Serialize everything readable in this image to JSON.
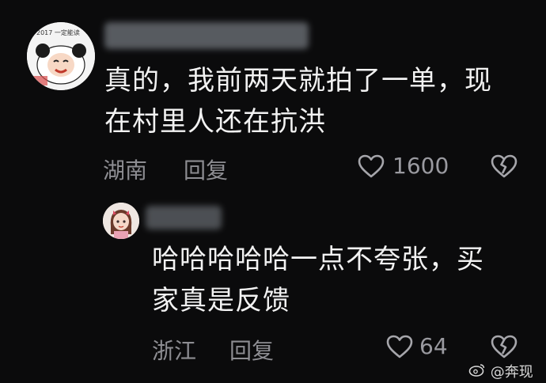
{
  "comments": [
    {
      "avatar_text": "2017 一定能读",
      "text_lines": [
        "真的，我前两天就拍了一单，现",
        "在村里人还在抗洪"
      ],
      "location": "湖南",
      "reply_label": "回复",
      "likes": "1600"
    },
    {
      "text_lines": [
        "哈哈哈哈哈一点不夸张，买",
        "家真是反馈"
      ],
      "location": "浙江",
      "reply_label": "回复",
      "likes": "64"
    }
  ],
  "watermark": "@奔现",
  "colors": {
    "background": "#0b0b0c",
    "meta": "#8d8d92",
    "text": "#f2f2f2"
  },
  "icons": [
    "heart-outline-icon",
    "broken-heart-icon",
    "weibo-logo-icon"
  ]
}
